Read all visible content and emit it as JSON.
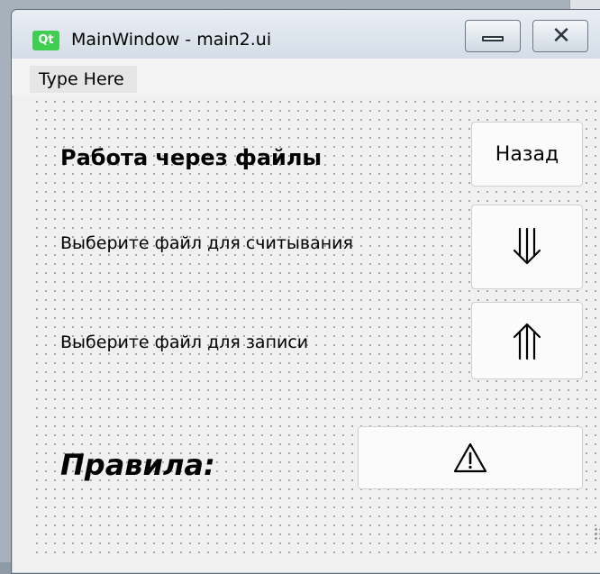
{
  "window": {
    "title": "MainWindow - main2.ui",
    "logo_text": "Qt"
  },
  "menubar": {
    "item": "Type Here"
  },
  "labels": {
    "heading": "Работа через файлы",
    "read": "Выберите файл для считывания",
    "write": "Выберите файл для записи",
    "rules": "Правила:"
  },
  "buttons": {
    "back": "Назад",
    "read_icon": "⟱",
    "write_icon": "⟰",
    "rules_icon": "⚠"
  },
  "icons": {
    "minimize": "minimize-icon",
    "close": "close-icon",
    "read": "triple-down-arrow-icon",
    "write": "triple-up-arrow-icon",
    "rules": "warning-icon"
  }
}
